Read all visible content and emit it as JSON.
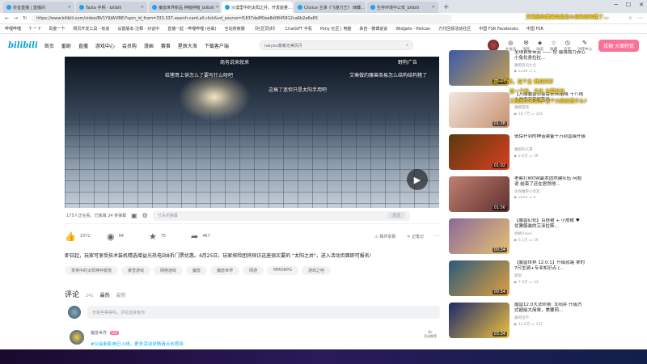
{
  "browser": {
    "tabs": [
      {
        "label": "抖音直播 | 直播间",
        "active": false
      },
      {
        "label": "Tazta 手柄 - bilibili",
        "active": false
      },
      {
        "label": "魔兽世界新品 种植种植_bilibili",
        "active": false
      },
      {
        "label": "沙漠里中的太阳之井，开发能量…",
        "active": true
      },
      {
        "label": "Choice 主演《飞驰刀王》 西藏…",
        "active": false
      },
      {
        "label": "生存环境中公安_bilibili",
        "active": false
      }
    ],
    "url": "https://www.bilibili.com/video/BV1Y9jWVBE/?spm_id_from=333.337.search-card.all.click&vd_source=f1837da8f0ea8d0845812ca6b2a6e65",
    "bookmarks": [
      "哔哩哔哩",
      "Y 一 Y",
      "百度一下",
      "网页开发工具 - 有道",
      "设置版本-注释 - 对话中",
      "直播一起 - 哔哩哔哩 (谷歌)",
      "全站搜索服",
      "【社区同步】",
      "ChatGPT 手机",
      "Pony 社区 | 电脑",
      "来自 - 微博说说",
      "Widgets - Pelican",
      "万代回馈活动社区",
      "中国 FSR Facebooks",
      "中国 FSR"
    ]
  },
  "header": {
    "logo": "bilibili",
    "nav": [
      "首页",
      "番剧",
      "直播",
      "游戏中心",
      "会员购",
      "漫画",
      "赛事",
      "星辰大海",
      "下载客户端"
    ],
    "search_placeholder": "naiyou泰裔无美风丹",
    "icons": [
      {
        "label": "大会员",
        "glyph": "◎"
      },
      {
        "label": "消息",
        "glyph": "✉"
      },
      {
        "label": "动态",
        "glyph": "◈"
      },
      {
        "label": "收藏",
        "glyph": "☆"
      },
      {
        "label": "历史",
        "glyph": "◷"
      },
      {
        "label": "创作中心",
        "glyph": "✎"
      }
    ],
    "upload": "投稿·大面积鼠"
  },
  "player": {
    "danmaku": [
      "商务说来就来",
      "野狗广告",
      "给猪哥上供怎么了要写什么呀吧",
      "艾琳做的魔兽商易怎么结构结构猪了",
      "这搞了迷但只是太阳手用吧"
    ]
  },
  "danmaku_bar": {
    "info": "175人正在看，已装填 34 条弹幕",
    "placeholder": "已关闭弹幕",
    "send": "发送"
  },
  "actions": {
    "like": "1072",
    "coin": "94",
    "fav": "75",
    "share": "467",
    "report": "稿件举报",
    "note": "记笔记"
  },
  "description": "即日起，玩家可享受技术装机精选增益光热电站8折门票优惠。4月25日，玩家探险团将探访这座很买要的 \"太阳之井\"，进入活动页面即可报名!",
  "tags": [
    "茶荒中的太阳神存银落",
    "暴雪游戏",
    "网络游戏",
    "魔兽",
    "魔兽世界",
    "网游",
    "MMORPG",
    "游戏之吧"
  ],
  "comments": {
    "title": "评论",
    "count": "241",
    "sort_hot": "最热",
    "sort_new": "最新",
    "input_placeholder": "天有些等得吗，评论这就有你",
    "first": {
      "name": "魔兽世界",
      "level": "LV6",
      "text": "#公会新影响已上线，更多活动详情请点击官网",
      "badge": "HL\n活动推荐"
    }
  },
  "recommendations": [
    {
      "title": "全球首条带云 —— 但 最强战力赤心小兔化身拉拉...",
      "uploader": "魔兽资讯大全",
      "views": "2239",
      "danmaku": "1",
      "duration": "03:47",
      "colors": [
        "#3a5aa8",
        "#c8a050"
      ]
    },
    {
      "title": "【万面魔兽公会会长ns诺降 十八线小游手万苦是苦吗 —",
      "uploader": "魔都游戏",
      "views": "19.7万",
      "danmaku": "144",
      "duration": "01:38",
      "colors": [
        "#f0e6e0",
        "#c89070"
      ]
    },
    {
      "title": "低保开到的神话装备千万别直接升级",
      "uploader": "魔都的头罩",
      "views": "2.6万",
      "danmaku": "39",
      "duration": "01:02",
      "colors": [
        "#5a3a10",
        "#d84020"
      ]
    },
    {
      "title": "老蔡打WOW副本团然建队伍 问题说 结束了还在居然他...",
      "uploader": "生保魔兽小老友",
      "views": "2023",
      "danmaku": "0",
      "duration": "01:56",
      "colors": [
        "#c08070",
        "#603030"
      ]
    },
    {
      "title": "【魔兽幻化】百搭裙 + 小皮靴 ♥ 优雅服装的艾泽拉斯...",
      "uploader": "桃桃Dawn",
      "views": "6.1万",
      "danmaku": "19",
      "duration": "00:34",
      "colors": [
        "#8a6a9a",
        "#e8c070"
      ]
    },
    {
      "title": "【魔兽世界 12.0.1】升级就路 拿的7尺坐骑+专业知识点 (...",
      "uploader": "超帮",
      "views": "7.9万",
      "danmaku": "13",
      "duration": "00:54",
      "colors": [
        "#2a5a7a",
        "#e0a040"
      ]
    },
    {
      "title": "魔兽12.0大法师限: 太阳井 升级方式超级大简单，美要莉...",
      "uploader": "豪莉坚不",
      "views": "13.6万",
      "danmaku": "137",
      "duration": "03:34",
      "colors": [
        "#1a2a6a",
        "#f0c040"
      ]
    }
  ],
  "stream_overlay": [
    "艾琳做的魔兽商易怎么结构结构猪了...",
    "这一个机，这个主 就说好好",
    "这一个机，文化 主要当当",
    "三联美的来点赞 这个大回应是什么?"
  ]
}
